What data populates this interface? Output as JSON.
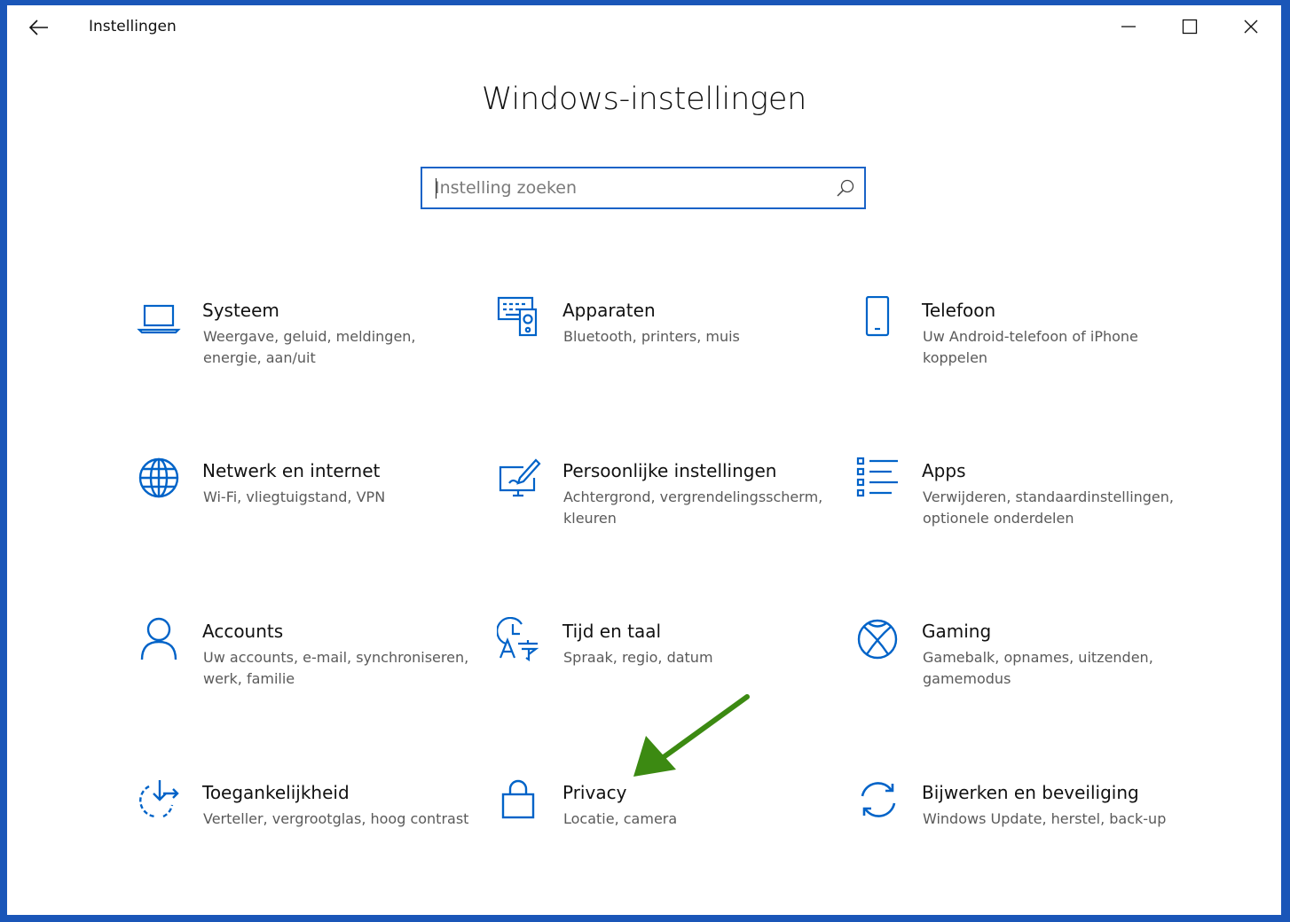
{
  "window": {
    "app_title": "Instellingen",
    "controls": [
      "minimize-icon",
      "maximize-icon",
      "close-icon"
    ]
  },
  "header": {
    "page_title": "Windows-instellingen"
  },
  "search": {
    "placeholder": "Instelling zoeken",
    "value": ""
  },
  "colors": {
    "accent": "#0063C8",
    "annotation_arrow": "#3C8A12",
    "frame": "#1A56B8"
  },
  "tiles": [
    {
      "title": "Systeem",
      "description": "Weergave, geluid, meldingen, energie, aan/uit",
      "icon": "laptop-icon"
    },
    {
      "title": "Apparaten",
      "description": "Bluetooth, printers, muis",
      "icon": "devices-icon"
    },
    {
      "title": "Telefoon",
      "description": "Uw Android-telefoon of iPhone koppelen",
      "icon": "phone-icon"
    },
    {
      "title": "Netwerk en internet",
      "description": "Wi-Fi, vliegtuigstand, VPN",
      "icon": "globe-icon"
    },
    {
      "title": "Persoonlijke instellingen",
      "description": "Achtergrond, vergrendelingsscherm, kleuren",
      "icon": "personalization-icon"
    },
    {
      "title": "Apps",
      "description": "Verwijderen, standaardinstellingen, optionele onderdelen",
      "icon": "apps-list-icon"
    },
    {
      "title": "Accounts",
      "description": "Uw accounts, e-mail, synchroniseren, werk, familie",
      "icon": "person-icon"
    },
    {
      "title": "Tijd en taal",
      "description": "Spraak, regio, datum",
      "icon": "time-language-icon"
    },
    {
      "title": "Gaming",
      "description": "Gamebalk, opnames, uitzenden, gamemodus",
      "icon": "xbox-icon"
    },
    {
      "title": "Toegankelijkheid",
      "description": "Verteller, vergrootglas, hoog contrast",
      "icon": "accessibility-icon"
    },
    {
      "title": "Privacy",
      "description": "Locatie, camera",
      "icon": "lock-icon"
    },
    {
      "title": "Bijwerken en beveiliging",
      "description": "Windows Update, herstel, back-up",
      "icon": "sync-icon"
    }
  ]
}
